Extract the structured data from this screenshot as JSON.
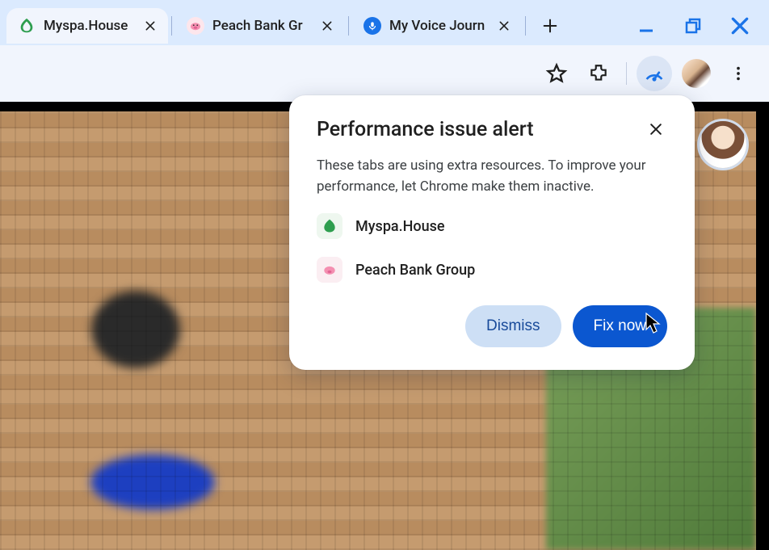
{
  "tabs": [
    {
      "title": "Myspa.House",
      "icon": "leaf",
      "active": true,
      "closable": true
    },
    {
      "title": "Peach Bank Gr",
      "icon": "pig",
      "active": false,
      "closable": true
    },
    {
      "title": "My Voice Journ",
      "icon": "mic",
      "active": false,
      "closable": true
    }
  ],
  "window_controls": {
    "minimize": "minimize",
    "restore": "restore",
    "close": "close"
  },
  "toolbar": {
    "star": "star",
    "extensions": "puzzle",
    "performance": "speedometer",
    "profile": "profile-avatar",
    "menu": "kebab"
  },
  "alert": {
    "title": "Performance issue alert",
    "description": "These tabs are using extra resources. To improve your performance, let Chrome make them inactive.",
    "tabs": [
      {
        "icon": "leaf",
        "name": "Myspa.House"
      },
      {
        "icon": "pig",
        "name": "Peach Bank Group"
      }
    ],
    "dismiss_label": "Dismiss",
    "fix_label": "Fix now"
  }
}
